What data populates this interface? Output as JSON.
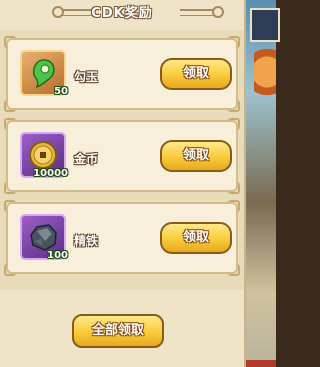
{
  "header": {
    "title": "CDK奖励"
  },
  "rewards": [
    {
      "name": "勾玉",
      "quantity": "50",
      "icon": "jade-icon",
      "claim_label": "领取"
    },
    {
      "name": "金币",
      "quantity": "10000",
      "icon": "coin-icon",
      "claim_label": "领取"
    },
    {
      "name": "精铁",
      "quantity": "100",
      "icon": "iron-ore-icon",
      "claim_label": "领取"
    }
  ],
  "footer": {
    "claim_all_label": "全部领取"
  },
  "colors": {
    "panel_bg": "#efe4c7",
    "button_gold": "#f7cb3a",
    "button_border": "#8a5a1a",
    "jade_green": "#3fae3c",
    "rare_purple": "#9d5ec6"
  }
}
